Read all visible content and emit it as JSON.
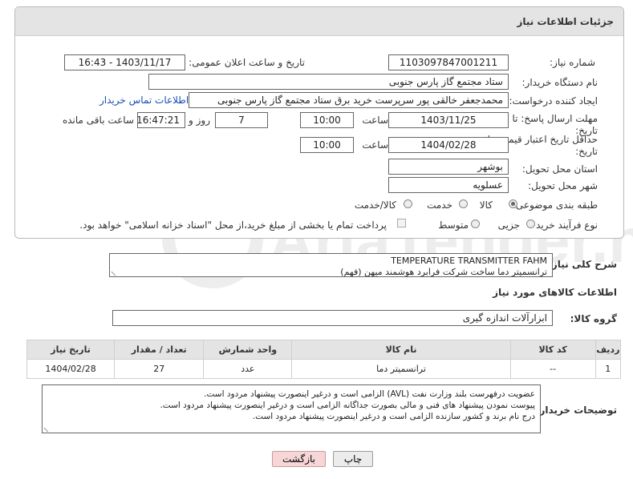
{
  "header": {
    "title": "جزئیات اطلاعات نیاز"
  },
  "need_number": {
    "label": "شماره نیاز:",
    "value": "1103097847001211"
  },
  "announce_datetime": {
    "label": "تاریخ و ساعت اعلان عمومی:",
    "value": "1403/11/17 - 16:43"
  },
  "buyer_org": {
    "label": "نام دستگاه خریدار:",
    "value": "ستاد مجتمع گاز پارس جنوبی"
  },
  "requester": {
    "label": "ایجاد کننده درخواست:",
    "value": "محمدجعفر خالقی پور سرپرست خرید برق ستاد مجتمع گاز پارس جنوبی",
    "contact_link": "اطلاعات تماس خریدار"
  },
  "response_deadline": {
    "label_line1": "مهلت ارسال پاسخ: تا",
    "label_line2": "تاریخ:",
    "date": "1403/11/25",
    "time_label": "ساعت",
    "time": "10:00",
    "days": "7",
    "days_label": "روز و",
    "remaining": "16:47:21",
    "remaining_label": "ساعت باقی مانده"
  },
  "price_validity": {
    "label_line1": "حداقل تاریخ اعتبار قیمت: تا",
    "label_line2": "تاریخ:",
    "date": "1404/02/28",
    "time_label": "ساعت",
    "time": "10:00"
  },
  "province": {
    "label": "استان محل تحویل:",
    "value": "بوشهر"
  },
  "city": {
    "label": "شهر محل تحویل:",
    "value": "عسلویه"
  },
  "category": {
    "label": "طبقه بندی موضوعی:",
    "options": [
      "کالا",
      "خدمت",
      "کالا/خدمت"
    ],
    "selected": "کالا"
  },
  "process_type": {
    "label": "نوع فرآیند خرید :",
    "options": [
      "جزیی",
      "متوسط"
    ],
    "payment_note": "پرداخت تمام یا بخشی از مبلغ خرید،از محل \"اسناد خزانه اسلامی\" خواهد بود."
  },
  "general_description": {
    "label": "شرح کلی نیاز:",
    "line1": "TEMPERATURE TRANSMITTER FAHM",
    "line2": "ترانسمیتر دما ساخت شرکت فرابرد هوشمند میهن (فهم)"
  },
  "goods_info_title": "اطلاعات کالاهای مورد نیاز",
  "goods_group": {
    "label": "گروه کالا:",
    "value": "ابزارآلات اندازه گیری"
  },
  "table": {
    "headers": [
      "ردیف",
      "کد کالا",
      "نام کالا",
      "واحد شمارش",
      "تعداد / مقدار",
      "تاریخ نیاز"
    ],
    "rows": [
      [
        "1",
        "--",
        "ترانسمیتر دما",
        "عدد",
        "27",
        "1404/02/28"
      ]
    ]
  },
  "buyer_notes": {
    "label": "توضیحات خریدار:",
    "lines": [
      "عضویت درفهرست بلند وزارت نفت (AVL) الزامی است و درغیر اینصورت پیشنهاد مردود است.",
      "پیوست نمودن پیشنهاد های فنی و مالی بصورت جداگانه الزامی است و درغیر اینصورت پیشنهاد مردود است.",
      "درج نام برند و کشور سازنده الزامی است و درغیر اینصورت پیشنهاد مردود است."
    ]
  },
  "buttons": {
    "print": "چاپ",
    "back": "بازگشت"
  },
  "watermark_text": "AriaTender.neT",
  "colors": {
    "header_bg": "#e4e4e4",
    "link": "#1a4fb4",
    "back_button_bg": "#f7d6d8"
  }
}
